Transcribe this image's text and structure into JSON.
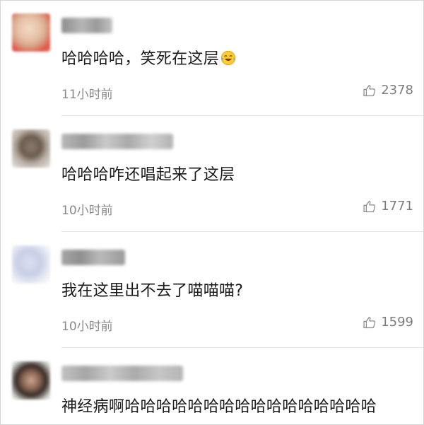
{
  "comments": [
    {
      "text": "哈哈哈哈，笑死在这层",
      "emoji": "laughing-tears-emoji",
      "time": "11小时前",
      "likes": "2378"
    },
    {
      "text": "哈哈哈咋还唱起来了这层",
      "time": "10小时前",
      "likes": "1771"
    },
    {
      "text": "我在这里出不去了喵喵喵?",
      "time": "10小时前",
      "likes": "1599"
    },
    {
      "text": "神经病啊哈哈哈哈哈哈哈哈哈哈哈哈哈哈哈哈"
    }
  ],
  "colors": {
    "text": "#1a1a1a",
    "meta": "#8a8a8a",
    "divider": "#e4e4e4"
  }
}
